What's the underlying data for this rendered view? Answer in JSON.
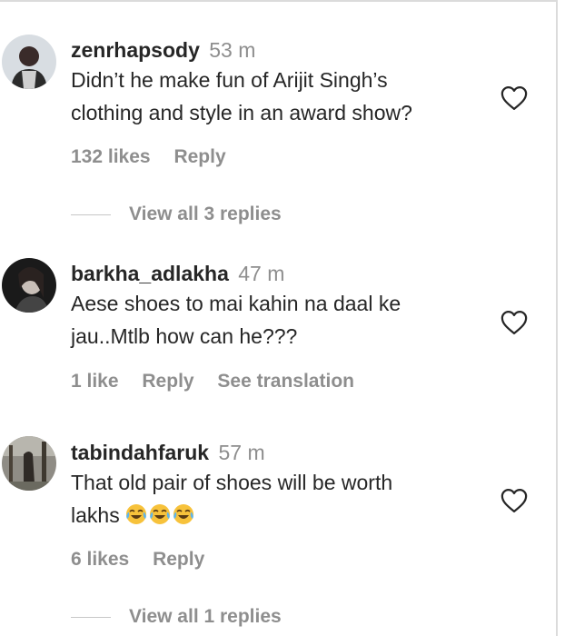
{
  "comments": [
    {
      "username": "zenrhapsody",
      "time": "53 m",
      "text_lines": [
        "Didn’t he make fun of Arijit Singh’s",
        "clothing and style in an award show?"
      ],
      "likes": "132 likes",
      "reply": "Reply",
      "view_replies": "View all 3 replies"
    },
    {
      "username": "barkha_adlakha",
      "time": "47 m",
      "text_lines": [
        "Aese shoes to mai kahin na daal ke",
        "jau..Mtlb how can he???"
      ],
      "likes": "1 like",
      "reply": "Reply",
      "see_translation": "See translation"
    },
    {
      "username": "tabindahfaruk",
      "time": "57 m",
      "text_lines": [
        "That old pair of shoes will be worth",
        "lakhs"
      ],
      "emoji": [
        "face-with-tears-of-joy",
        "face-with-tears-of-joy",
        "face-with-tears-of-joy"
      ],
      "likes": "6 likes",
      "reply": "Reply",
      "view_replies": "View all 1 replies"
    }
  ],
  "colors": {
    "text": "#262626",
    "secondary": "#8e8e8e",
    "divider": "#dbdbdb"
  },
  "icons": {
    "like": "heart-outline-icon",
    "emoji": "face-with-tears-of-joy"
  }
}
